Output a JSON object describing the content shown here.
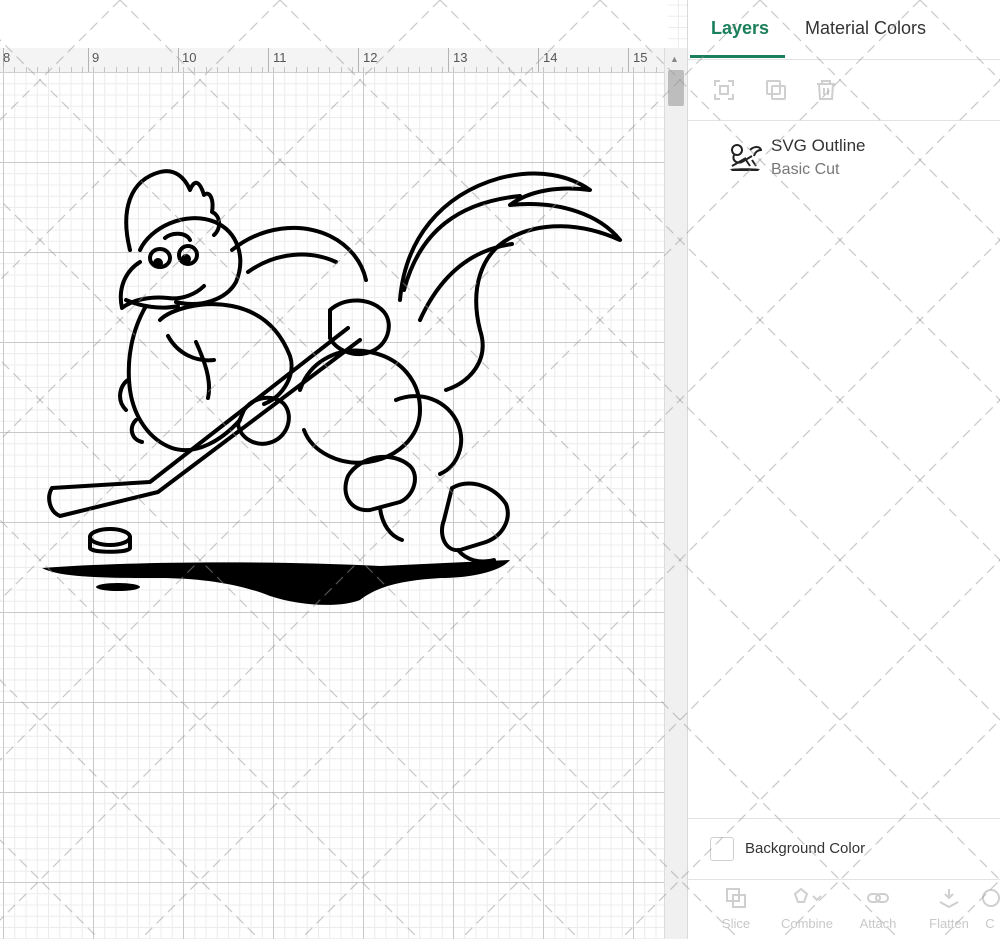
{
  "ruler": {
    "labels": [
      "8",
      "9",
      "10",
      "11",
      "12",
      "13",
      "14",
      "15"
    ]
  },
  "panel": {
    "tabs": {
      "layers": "Layers",
      "material_colors": "Material Colors"
    },
    "toolbar_icons": [
      "group-icon",
      "duplicate-icon",
      "delete-icon"
    ],
    "layer": {
      "name": "SVG Outline",
      "operation": "Basic Cut",
      "thumbnail_icon": "hockey-mascot-thumbnail"
    },
    "background_color_label": "Background Color",
    "bottom_tools": [
      {
        "label": "Slice",
        "icon": "slice-icon"
      },
      {
        "label": "Combine",
        "icon": "combine-icon"
      },
      {
        "label": "Attach",
        "icon": "attach-icon"
      },
      {
        "label": "Flatten",
        "icon": "flatten-icon"
      },
      {
        "label": "C",
        "icon": "contour-icon"
      }
    ]
  },
  "colors": {
    "accent": "#1a7f5a",
    "grid_major": "#c9c9c9",
    "grid_minor": "#ececec",
    "artwork": "#000000"
  }
}
